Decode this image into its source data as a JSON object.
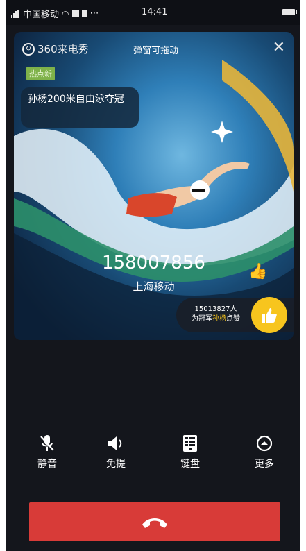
{
  "status_bar": {
    "carrier": "中国移动",
    "extra_icons": "⋯",
    "time": "14:41"
  },
  "promo_card": {
    "brand": "360来电秀",
    "drag_hint": "弹窗可拖动",
    "close_icon": "close-icon",
    "badge": "热点新",
    "headline": "孙杨200米自由泳夺冠",
    "colors": {
      "card_bg": "#2f7fb8",
      "like_yellow": "#f7c51e",
      "badge_green": "#7fb24a"
    }
  },
  "caller": {
    "number": "158007856",
    "carrier": "上海移动"
  },
  "likes": {
    "count_line": "15013827人",
    "cheer_prefix": "为冠军",
    "cheer_name": "孙杨",
    "cheer_suffix": "点赞"
  },
  "controls": {
    "mute": {
      "label": "静音",
      "icon": "mic-off-icon"
    },
    "speaker": {
      "label": "免提",
      "icon": "speaker-icon"
    },
    "keypad": {
      "label": "键盘",
      "icon": "keypad-icon"
    },
    "more": {
      "label": "更多",
      "icon": "more-icon"
    }
  },
  "hangup": {
    "icon": "hangup-phone-icon",
    "color": "#d83b38"
  }
}
